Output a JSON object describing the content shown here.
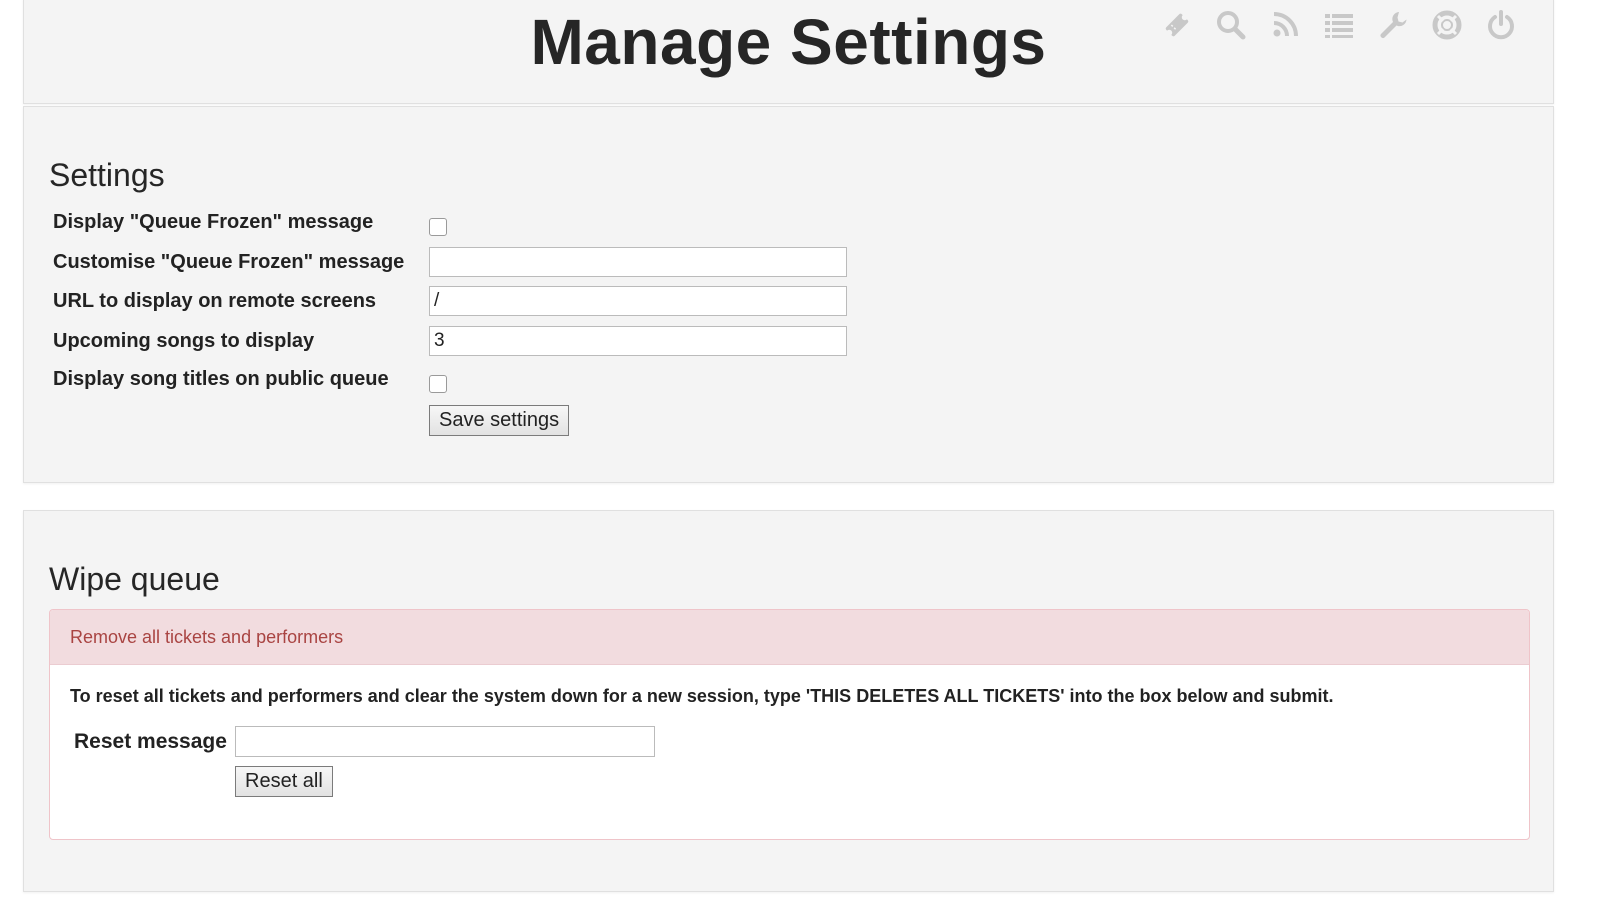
{
  "header": {
    "title": "Manage Settings",
    "icons": [
      {
        "name": "ticket-icon"
      },
      {
        "name": "search-icon"
      },
      {
        "name": "rss-icon"
      },
      {
        "name": "list-icon"
      },
      {
        "name": "wrench-icon"
      },
      {
        "name": "lifebuoy-icon"
      },
      {
        "name": "power-icon"
      }
    ],
    "icon_color": "#c8c8c8"
  },
  "settings": {
    "heading": "Settings",
    "fields": {
      "queue_frozen_label": "Display \"Queue Frozen\" message",
      "queue_frozen_checked": false,
      "custom_message_label": "Customise \"Queue Frozen\" message",
      "custom_message_value": "",
      "remote_url_label": "URL to display on remote screens",
      "remote_url_value": "/",
      "upcoming_label": "Upcoming songs to display",
      "upcoming_value": "3",
      "song_titles_label": "Display song titles on public queue",
      "song_titles_checked": false
    },
    "save_label": "Save settings"
  },
  "wipe": {
    "heading": "Wipe queue",
    "alert_title": "Remove all tickets and performers",
    "instructions": "To reset all tickets and performers and clear the system down for a new session, type 'THIS DELETES ALL TICKETS' into the box below and submit.",
    "reset_label": "Reset message",
    "reset_value": "",
    "reset_button": "Reset all"
  },
  "colors": {
    "alert_text": "#a94442",
    "alert_bg": "#f2dcdf",
    "panel_bg": "#f4f4f4"
  }
}
